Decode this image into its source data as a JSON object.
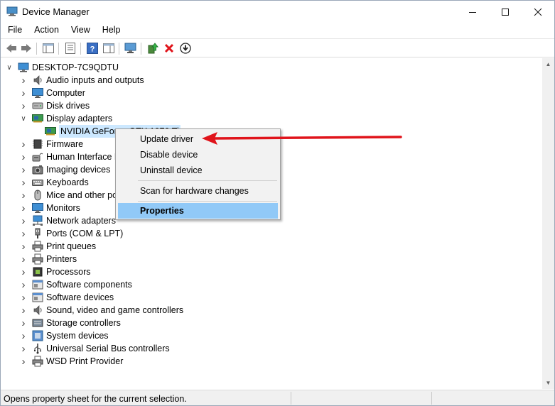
{
  "window": {
    "title": "Device Manager"
  },
  "menubar": [
    "File",
    "Action",
    "View",
    "Help"
  ],
  "tree": {
    "root": "DESKTOP-7C9QDTU",
    "nodes": [
      {
        "label": "Audio inputs and outputs",
        "icon": "speaker-icon"
      },
      {
        "label": "Computer",
        "icon": "monitor-icon"
      },
      {
        "label": "Disk drives",
        "icon": "disk-icon"
      },
      {
        "label": "Display adapters",
        "icon": "display-adapter-icon",
        "expanded": true
      },
      {
        "label": "NVIDIA GeForce GTX 1070 Ti",
        "icon": "display-adapter-icon",
        "child": true,
        "selected": true
      },
      {
        "label": "Firmware",
        "icon": "chip-icon"
      },
      {
        "label": "Human Interface Devices",
        "icon": "hid-icon"
      },
      {
        "label": "Imaging devices",
        "icon": "camera-icon"
      },
      {
        "label": "Keyboards",
        "icon": "keyboard-icon"
      },
      {
        "label": "Mice and other pointing devices",
        "icon": "mouse-icon"
      },
      {
        "label": "Monitors",
        "icon": "monitor-icon"
      },
      {
        "label": "Network adapters",
        "icon": "network-icon"
      },
      {
        "label": "Ports (COM & LPT)",
        "icon": "port-icon"
      },
      {
        "label": "Print queues",
        "icon": "printer-icon"
      },
      {
        "label": "Printers",
        "icon": "printer-icon"
      },
      {
        "label": "Processors",
        "icon": "processor-icon"
      },
      {
        "label": "Software components",
        "icon": "software-icon"
      },
      {
        "label": "Software devices",
        "icon": "software-icon"
      },
      {
        "label": "Sound, video and game controllers",
        "icon": "speaker-icon"
      },
      {
        "label": "Storage controllers",
        "icon": "storage-icon"
      },
      {
        "label": "System devices",
        "icon": "system-icon"
      },
      {
        "label": "Universal Serial Bus controllers",
        "icon": "usb-icon"
      },
      {
        "label": "WSD Print Provider",
        "icon": "printer-icon"
      }
    ]
  },
  "context_menu": {
    "items": [
      "Update driver",
      "Disable device",
      "Uninstall device",
      "Scan for hardware changes",
      "Properties"
    ],
    "highlighted": "Properties"
  },
  "status": {
    "text": "Opens property sheet for the current selection."
  },
  "colors": {
    "accent_arrow": "#e0141b",
    "selection": "#cce8ff",
    "menu_highlight": "#91c9f7",
    "delete_x": "#e0141b"
  }
}
